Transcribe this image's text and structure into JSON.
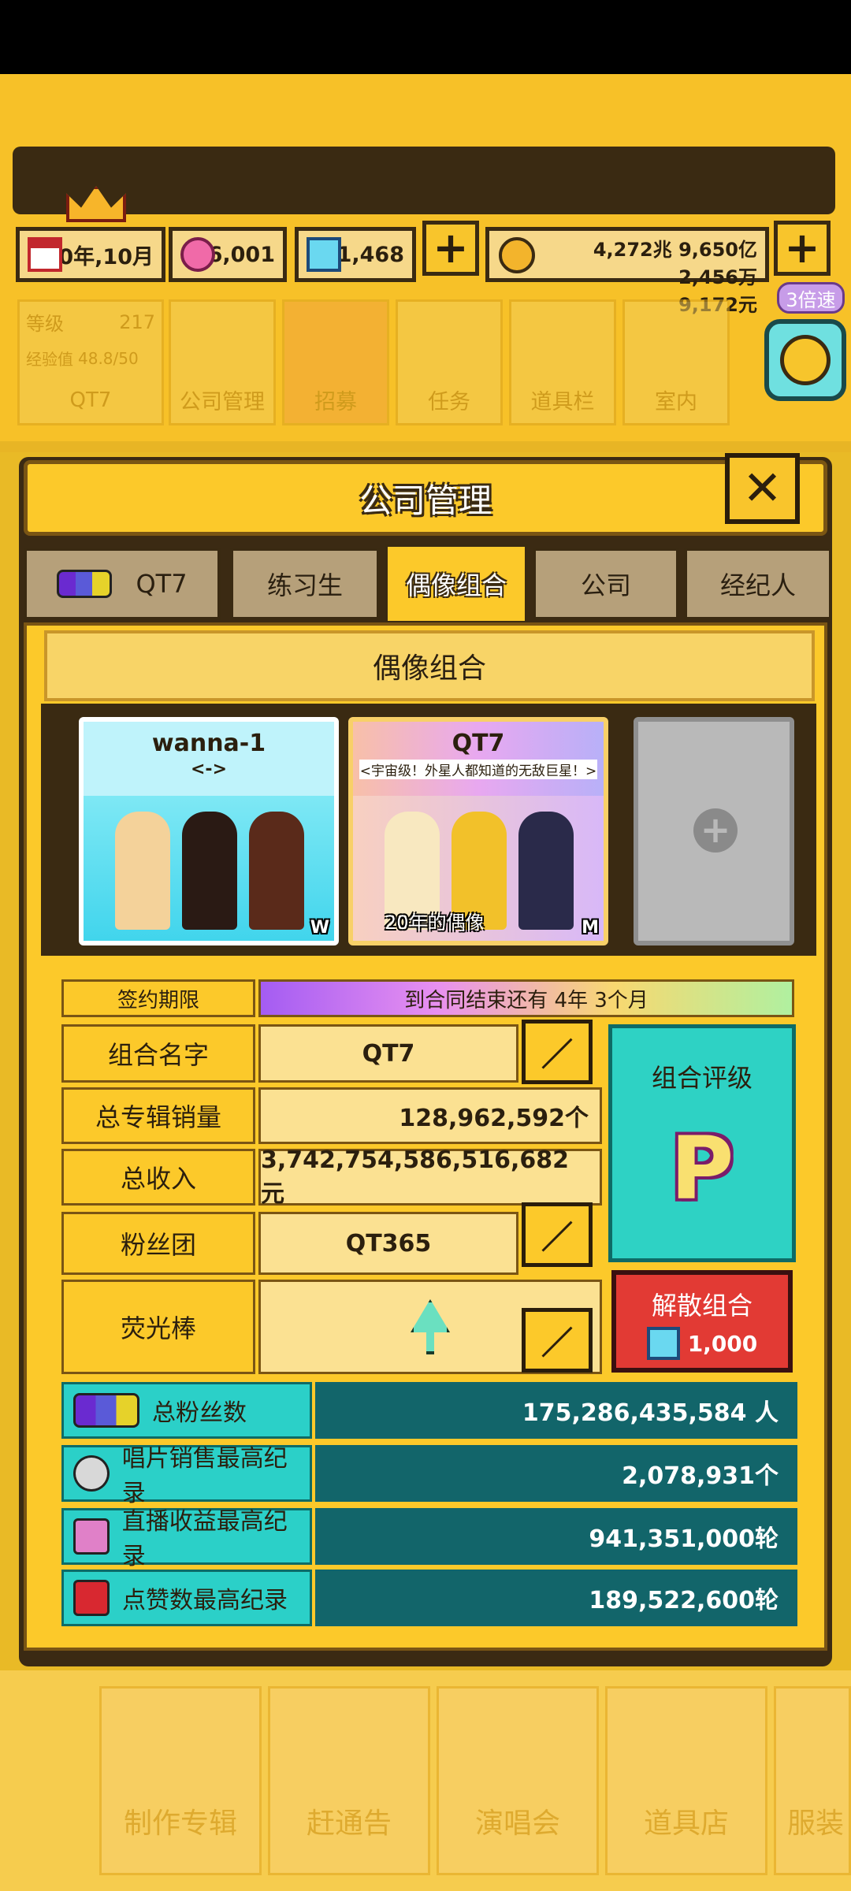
{
  "resources": {
    "date": "20年,10月",
    "gems": "6,001",
    "diamonds": "11,468",
    "money_line1": "4,272兆 9,650亿 2,456万",
    "money_line2": "9,172元"
  },
  "speed": "3倍速",
  "hud": {
    "level_label": "等级",
    "level_value": "217",
    "exp_label": "经验值",
    "exp_value": "48.8/50",
    "company_name": "QT7"
  },
  "top_menu": [
    "公司管理",
    "招募",
    "任务",
    "道具栏",
    "室内"
  ],
  "dialog_title": "公司管理",
  "tabs": [
    "QT7",
    "练习生",
    "偶像组合",
    "公司",
    "经纪人"
  ],
  "section_title": "偶像组合",
  "groups": [
    {
      "name": "wanna-1",
      "sub": "<->",
      "corner": "W"
    },
    {
      "name": "QT7",
      "sub": "<宇宙级！外星人都知道的无敌巨星！>",
      "caption": "20年的偶像",
      "corner": "M"
    }
  ],
  "contract": {
    "label": "签约期限",
    "value": "到合同结束还有 4年 3个月"
  },
  "info": {
    "group_name_label": "组合名字",
    "group_name_value": "QT7",
    "album_sales_label": "总专辑销量",
    "album_sales_value": "128,962,592个",
    "revenue_label": "总收入",
    "revenue_value": "3,742,754,586,516,682元",
    "fanclub_label": "粉丝团",
    "fanclub_value": "QT365",
    "lightstick_label": "荧光棒",
    "rating_label": "组合评级",
    "rating_grade": "P",
    "disband_label": "解散组合",
    "disband_cost": "1,000"
  },
  "stats": [
    {
      "label": "总粉丝数",
      "value": "175,286,435,584 人"
    },
    {
      "label": "唱片销售最高纪录",
      "value": "2,078,931个"
    },
    {
      "label": "直播收益最高纪录",
      "value": "941,351,000轮"
    },
    {
      "label": "点赞数最高纪录",
      "value": "189,522,600轮"
    }
  ],
  "bottom_menu": [
    "制作专辑",
    "赶通告",
    "演唱会",
    "道具店",
    "服装"
  ]
}
